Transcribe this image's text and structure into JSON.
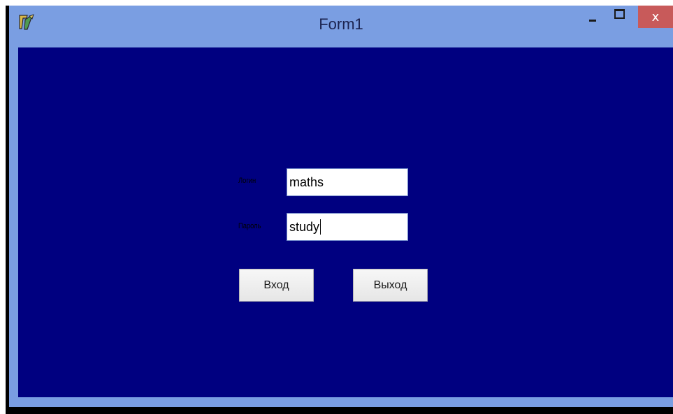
{
  "window": {
    "title": "Form1",
    "close_glyph": "x",
    "icon": "delphi-app-icon",
    "colors": {
      "frame": "#7a9ee2",
      "client": "#000080",
      "close": "#c85a5a"
    }
  },
  "form": {
    "login_label": "Логин",
    "password_label": "Пароль",
    "login_value": "maths",
    "password_value": "study",
    "enter_button": "Вход",
    "exit_button": "Выход"
  }
}
